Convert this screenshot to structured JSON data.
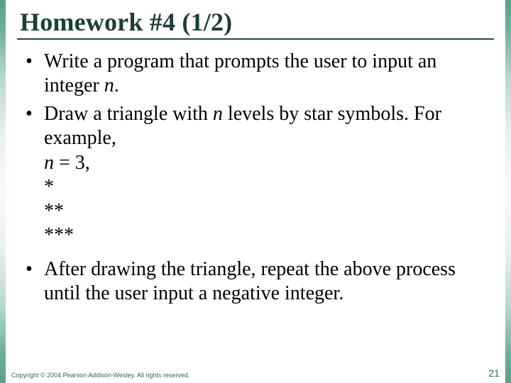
{
  "title": "Homework #4 (1/2)",
  "bullets": {
    "b1": {
      "pre": "Write a program that prompts the user to input an integer ",
      "var": "n",
      "post": "."
    },
    "b2": {
      "line1_pre": "Draw a triangle with ",
      "line1_var": "n",
      "line1_post": " levels by star symbols. For example,",
      "eq_var": "n",
      "eq_rest": " = 3,",
      "row1": "*",
      "row2": "**",
      "row3": "***"
    },
    "b3": "After drawing the triangle, repeat the above process until the user input a negative integer."
  },
  "footer": {
    "copyright": "Copyright © 2004 Pearson Addison-Wesley. All rights reserved.",
    "page": "21"
  }
}
